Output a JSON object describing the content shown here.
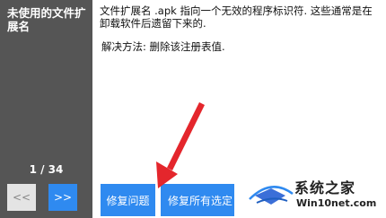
{
  "sidebar": {
    "title": "未使用的文件扩展名",
    "page_count": "1 / 34",
    "prev_label": "<<",
    "next_label": ">>"
  },
  "content": {
    "description": "文件扩展名 .apk 指向一个无效的程序标识符. 这些通常是在卸载软件后遗留下来的.",
    "fix_method": "解决方法: 删除该注册表值."
  },
  "actions": {
    "fix_label": "修复问题",
    "fix_all_label": "修复所有选定"
  },
  "watermark": {
    "title": "系统之家",
    "url": "Win10net.com"
  },
  "colors": {
    "accent": "#2f8af0",
    "sidebar": "#555555",
    "arrow": "#e4262c"
  }
}
